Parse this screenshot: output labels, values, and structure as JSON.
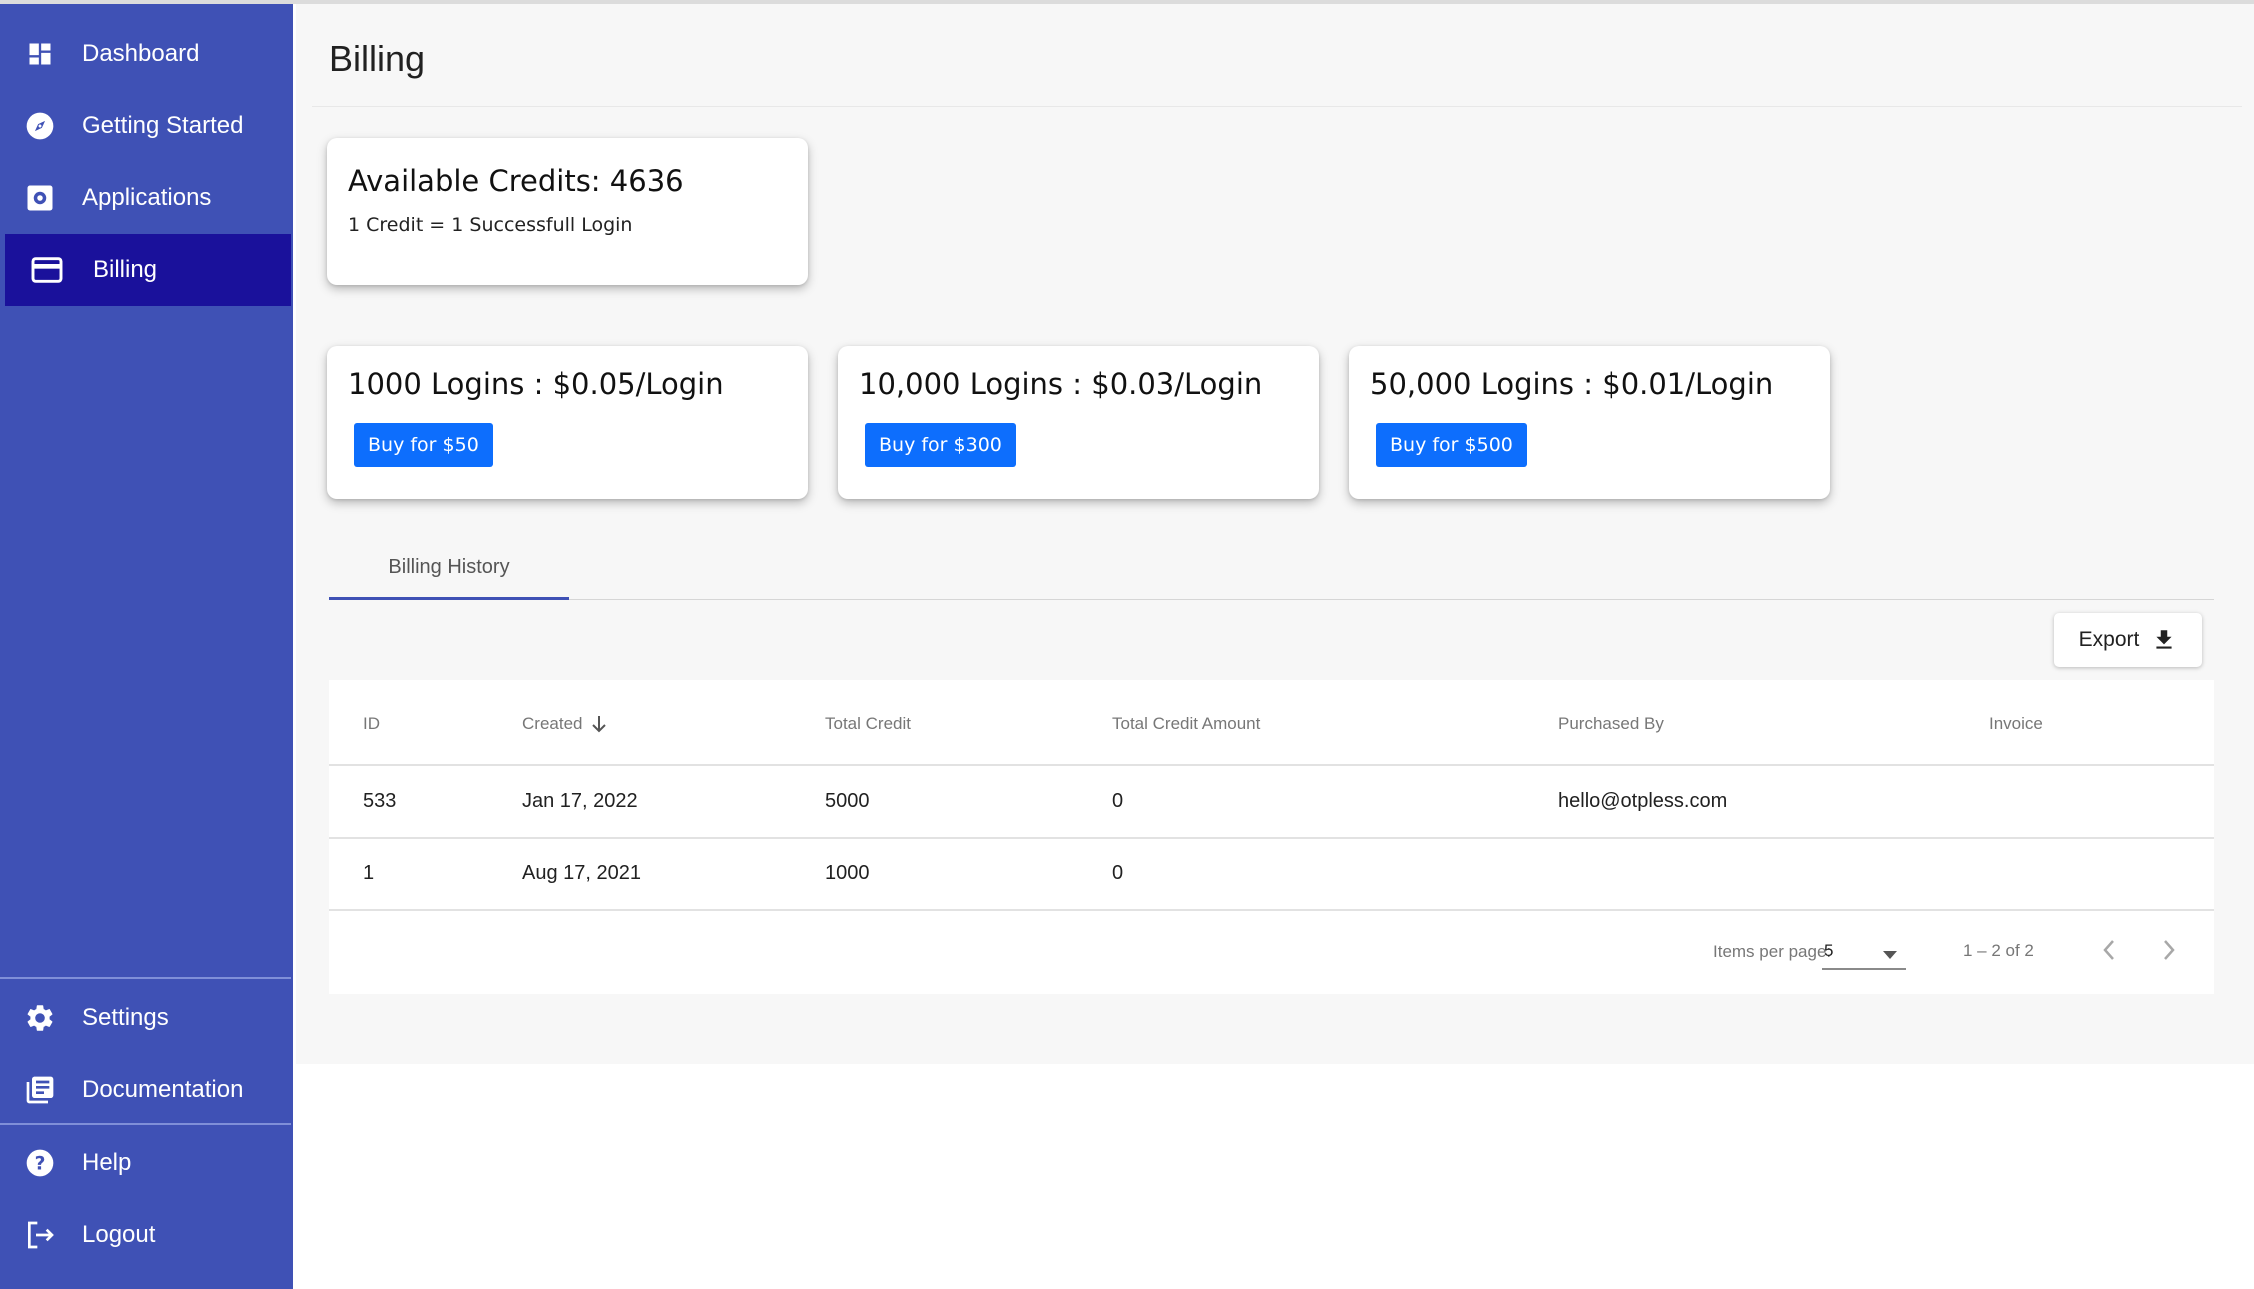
{
  "sidebar": {
    "items": [
      {
        "label": "Dashboard",
        "icon": "dashboard-icon",
        "active": false
      },
      {
        "label": "Getting Started",
        "icon": "compass-icon",
        "active": false
      },
      {
        "label": "Applications",
        "icon": "app-settings-icon",
        "active": false
      },
      {
        "label": "Billing",
        "icon": "credit-card-icon",
        "active": true
      }
    ],
    "bottom_items": [
      {
        "label": "Settings",
        "icon": "gear-icon"
      },
      {
        "label": "Documentation",
        "icon": "library-books-icon"
      },
      {
        "label": "Help",
        "icon": "help-icon"
      },
      {
        "label": "Logout",
        "icon": "logout-icon"
      }
    ]
  },
  "page": {
    "title": "Billing"
  },
  "credits_card": {
    "title": "Available Credits: 4636",
    "subtitle": "1 Credit = 1 Successfull Login"
  },
  "plans": [
    {
      "title": "1000 Logins : $0.05/Login",
      "button": "Buy for $50"
    },
    {
      "title": "10,000 Logins : $0.03/Login",
      "button": "Buy for $300"
    },
    {
      "title": "50,000 Logins : $0.01/Login",
      "button": "Buy for $500"
    }
  ],
  "tabs": [
    {
      "label": "Billing History",
      "active": true
    }
  ],
  "export": {
    "label": "Export",
    "icon": "download-icon"
  },
  "table": {
    "columns": [
      "ID",
      "Created",
      "Total Credit",
      "Total Credit Amount",
      "Purchased By",
      "Invoice"
    ],
    "sort": {
      "column": "Created",
      "direction": "desc",
      "icon": "arrow-down-icon"
    },
    "rows": [
      {
        "id": "533",
        "created": "Jan 17, 2022",
        "total_credit": "5000",
        "total_credit_amount": "0",
        "purchased_by": "hello@otpless.com",
        "invoice": ""
      },
      {
        "id": "1",
        "created": "Aug 17, 2021",
        "total_credit": "1000",
        "total_credit_amount": "0",
        "purchased_by": "",
        "invoice": ""
      }
    ]
  },
  "paginator": {
    "items_per_page_label": "Items per page:",
    "page_size": "5",
    "range": "1 – 2 of 2"
  },
  "colors": {
    "sidebar": "#3f51b5",
    "sidebar_active": "#1a119b",
    "primary_button": "#0d6efd",
    "main_background": "#f7f7f7"
  }
}
